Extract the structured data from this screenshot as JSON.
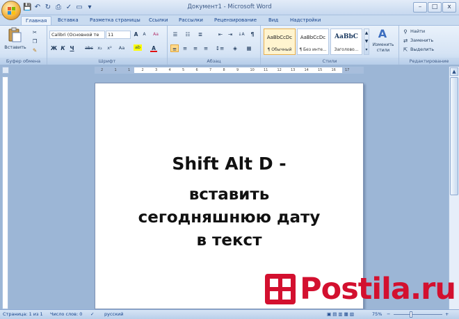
{
  "window": {
    "title": "Документ1 - Microsoft Word",
    "controls": {
      "minimize": "–",
      "maximize": "□",
      "close": "x"
    }
  },
  "quick_access": [
    {
      "icon": "save-icon",
      "glyph": "💾"
    },
    {
      "icon": "undo-icon",
      "glyph": "↶"
    },
    {
      "icon": "redo-icon",
      "glyph": "↻"
    },
    {
      "icon": "print-preview-icon",
      "glyph": "⎙"
    },
    {
      "icon": "spelling-icon",
      "glyph": "✓"
    },
    {
      "icon": "open-icon",
      "glyph": "▭"
    },
    {
      "icon": "customize-icon",
      "glyph": "▾"
    }
  ],
  "tabs": [
    "Главная",
    "Вставка",
    "Разметка страницы",
    "Ссылки",
    "Рассылки",
    "Рецензирование",
    "Вид",
    "Надстройки"
  ],
  "active_tab": "Главная",
  "ribbon": {
    "clipboard": {
      "label": "Буфер обмена",
      "paste": "Вставить"
    },
    "font": {
      "label": "Шрифт",
      "font_name": "Calibri (Основной те",
      "font_size": "11",
      "grow": "A",
      "shrink": "A",
      "clear": "Aa",
      "bold": "Ж",
      "italic": "К",
      "underline": "Ч",
      "strike": "abc",
      "subscript": "x₂",
      "superscript": "x²",
      "case": "Aa",
      "highlight": "ab",
      "color": "A"
    },
    "paragraph": {
      "label": "Абзац",
      "show_marks": "¶"
    },
    "styles": {
      "label": "Стили",
      "items": [
        {
          "sample": "AaBbCcDc",
          "name": "¶ Обычный",
          "selected": true
        },
        {
          "sample": "AaBbCcDc",
          "name": "¶ Без инте...",
          "selected": false
        },
        {
          "sample": "AaBbC",
          "name": "Заголово...",
          "selected": false
        }
      ],
      "change": "Изменить стили"
    },
    "editing": {
      "label": "Редактирование",
      "find": "Найти",
      "replace": "Заменить",
      "select": "Выделить"
    }
  },
  "ruler": {
    "top_numbers": [
      "2",
      "1",
      "1",
      "2",
      "3",
      "4",
      "5",
      "6",
      "7",
      "8",
      "9",
      "10",
      "11",
      "12",
      "13",
      "14",
      "15",
      "16",
      "17"
    ]
  },
  "document": {
    "line1": "Shift Alt D -",
    "line2": "вставить",
    "line3": "сегодняшнюю дату",
    "line4": "в текст"
  },
  "status_bar": {
    "page": "Страница: 1 из 1",
    "words": "Число слов: 0",
    "language": "русский",
    "zoom": "75%",
    "zoom_level_percent": 75
  },
  "watermark": {
    "text": "Postila.ru",
    "color": "#d3102f"
  },
  "colors": {
    "ribbon_blue": "#d6e4f5",
    "tab_text": "#15428b",
    "page": "#ffffff",
    "accent_red": "#d3102f"
  }
}
